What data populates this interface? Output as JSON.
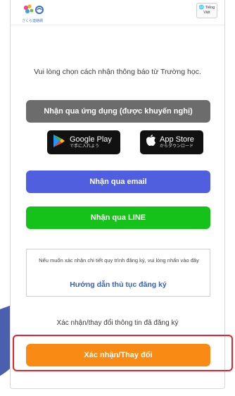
{
  "header": {
    "logo_caption": "さくら連絡網",
    "language_label": "Tiếng Việt"
  },
  "intro_text": "Vui lòng chọn cách nhận thông báo từ Trường học.",
  "app_button_label": "Nhận qua ứng dụng (được khuyến nghị)",
  "stores": {
    "google_main": "Google Play",
    "google_sub": "で手に入れよう",
    "apple_main": "App Store",
    "apple_sub": "からダウンロード"
  },
  "email_button_label": "Nhận qua email",
  "line_button_label": "Nhận qua LINE",
  "help": {
    "note": "Nếu muốn xác nhận chi tiết quy trình đăng ký, vui lòng nhấn vào đây",
    "link_label": "Hướng dẫn thủ tục đăng ký"
  },
  "confirm": {
    "label": "Xác nhận/thay đổi thông tin đã đăng ký",
    "button_label": "Xác nhận/Thay đổi"
  },
  "colors": {
    "app_button": "#6c6c6c",
    "email_button": "#4f5fe0",
    "line_button": "#15c21a",
    "confirm_button": "#f98a14",
    "highlight_frame": "#e8212a",
    "link": "#3a5fae"
  }
}
